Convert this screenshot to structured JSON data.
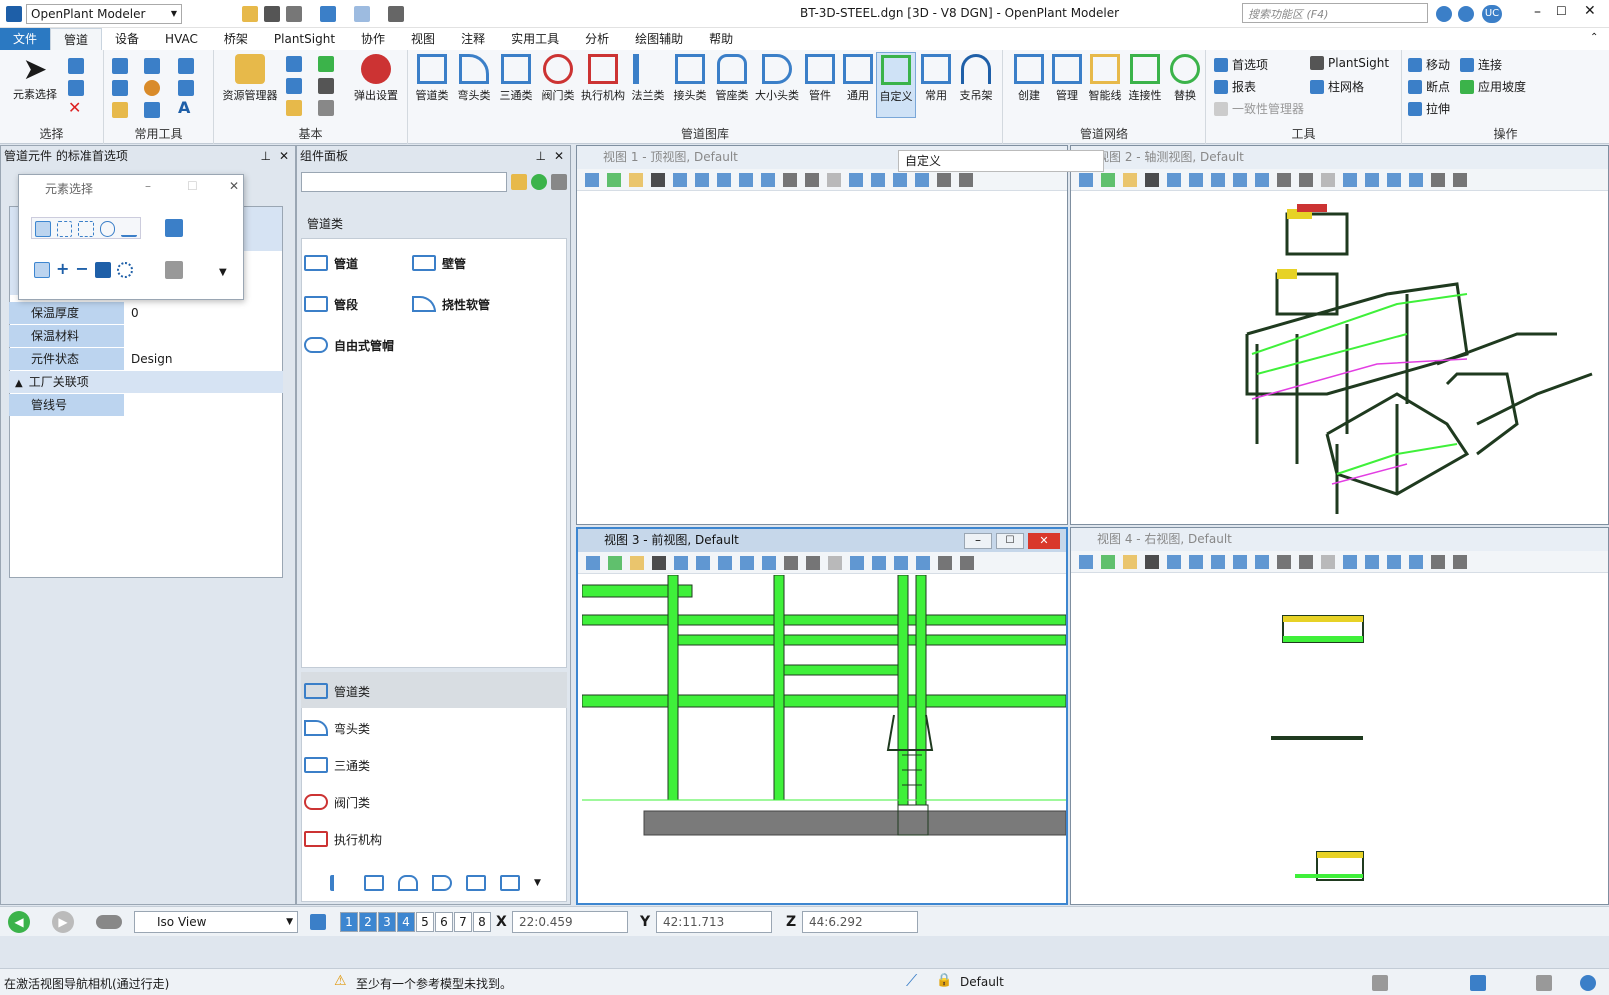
{
  "app": {
    "selector": "OpenPlant Modeler",
    "window_title": "BT-3D-STEEL.dgn [3D - V8 DGN] - OpenPlant Modeler",
    "search_placeholder": "搜索功能区 (F4)",
    "user": "UC"
  },
  "menu": [
    "文件",
    "管道",
    "设备",
    "HVAC",
    "桥架",
    "PlantSight",
    "协作",
    "视图",
    "注释",
    "实用工具",
    "分析",
    "绘图辅助",
    "帮助"
  ],
  "ribbon": {
    "groups": [
      "选择",
      "常用工具",
      "基本",
      "管道图库",
      "管道网络",
      "工具",
      "操作"
    ],
    "select": {
      "label": "元素选择"
    },
    "basic": {
      "resource_manager": "资源管理器",
      "popup_settings": "弹出设置"
    },
    "library": [
      "管道类",
      "弯头类",
      "三通类",
      "阀门类",
      "执行机构",
      "法兰类",
      "接头类",
      "管座类",
      "大小头类",
      "管件",
      "通用",
      "自定义",
      "常用",
      "支吊架"
    ],
    "network": [
      "创建",
      "管理",
      "智能线",
      "连接性",
      "替换"
    ],
    "tools": {
      "preferences": "首选项",
      "reports": "报表",
      "consistency": "一致性管理器",
      "plantsight": "PlantSight",
      "grid": "柱网格"
    },
    "ops": {
      "move": "移动",
      "connect": "连接",
      "break": "断点",
      "slope": "应用坡度",
      "stretch": "拉伸"
    },
    "tooltip": "自定义"
  },
  "left_panel": {
    "title": "管道元件 的标准首选项",
    "element_select_dialog": "元素选择",
    "properties": [
      {
        "name": "保温厚度",
        "value": "0"
      },
      {
        "name": "保温材料",
        "value": ""
      },
      {
        "name": "元件状态",
        "value": "Design"
      }
    ],
    "section": "工厂关联项",
    "section_props": [
      {
        "name": "管线号",
        "value": ""
      }
    ]
  },
  "component_panel": {
    "title": "组件面板",
    "category": "管道类",
    "items": [
      "管道",
      "壁管",
      "管段",
      "挠性软管",
      "自由式管帽"
    ],
    "bottom_list": [
      "管道类",
      "弯头类",
      "三通类",
      "阀门类",
      "执行机构"
    ]
  },
  "views": [
    {
      "title": "视图 1 - 顶视图, Default"
    },
    {
      "title": "视图 2 - 轴测视图, Default"
    },
    {
      "title": "视图 3 - 前视图, Default"
    },
    {
      "title": "视图 4 - 右视图, Default"
    }
  ],
  "status": {
    "view_mode": "Iso View",
    "view_numbers": [
      "1",
      "2",
      "3",
      "4",
      "5",
      "6",
      "7",
      "8"
    ],
    "x_label": "X",
    "x_value": "22:0.459",
    "y_label": "Y",
    "y_value": "42:11.713",
    "z_label": "Z",
    "z_value": "44:6.292",
    "message_left": "在激活视图导航相机(通过行走)",
    "message_warning": "至少有一个参考模型未找到。",
    "level": "Default"
  },
  "colors": {
    "accent": "#2b79c2",
    "pipe_green": "#3ff03a",
    "steel": "#1f3a1f",
    "selected_icon": "#3d86d0"
  }
}
